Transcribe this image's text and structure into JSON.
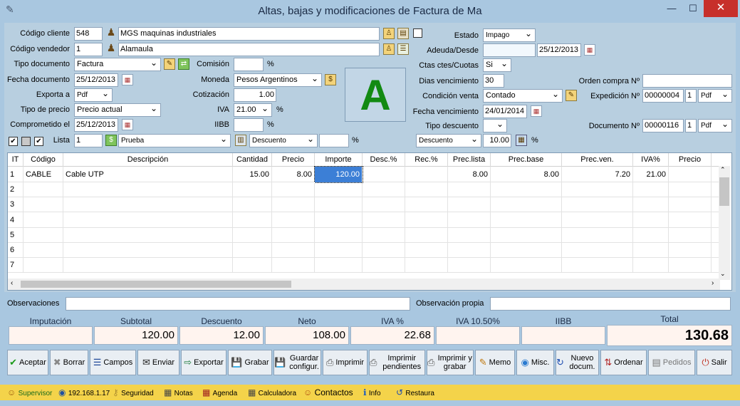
{
  "window": {
    "title": "Altas, bajas y modificaciones de Factura de Ma",
    "min": "—",
    "max": "☐",
    "close": "✕"
  },
  "header": {
    "codigo_cliente_label": "Código cliente",
    "codigo_cliente": "548",
    "cliente_nombre": "MGS maquinas industriales",
    "codigo_vendedor_label": "Código vendedor",
    "codigo_vendedor": "1",
    "vendedor_nombre": "Alamaula",
    "tipo_documento_label": "Tipo documento",
    "tipo_documento": "Factura",
    "comision_label": "Comisión",
    "comision": "",
    "pct": "%",
    "fecha_documento_label": "Fecha documento",
    "fecha_documento": "25/12/2013",
    "moneda_label": "Moneda",
    "moneda": "Pesos Argentinos",
    "exporta_label": "Exporta a",
    "exporta": "Pdf",
    "cotizacion_label": "Cotización",
    "cotizacion": "1.00",
    "tipo_precio_label": "Tipo de precio",
    "tipo_precio": "Precio actual",
    "iva_label": "IVA",
    "iva": "21.00",
    "comprometido_label": "Comprometido el",
    "comprometido": "25/12/2013",
    "iibb_label": "IIBB",
    "iibb": "",
    "lista_label": "Lista",
    "lista": "1",
    "lista_nombre": "Prueba",
    "descuento_tipo": "Descuento",
    "descuento_valor": "",
    "letra": "A",
    "estado_label": "Estado",
    "estado": "Impago",
    "adeuda_label": "Adeuda/Desde",
    "adeuda": "",
    "adeuda_fecha": "25/12/2013",
    "ctas_label": "Ctas ctes/Cuotas",
    "ctas": "Si",
    "dias_label": "Dias vencimiento",
    "dias": "30",
    "orden_label": "Orden compra Nº",
    "orden": "",
    "condicion_label": "Condición venta",
    "condicion": "Contado",
    "expedicion_label": "Expedición Nº",
    "expedicion": "00000004",
    "expedicion_n": "1",
    "expedicion_fmt": "Pdf",
    "fecha_venc_label": "Fecha vencimiento",
    "fecha_venc": "24/01/2014",
    "tipo_desc_label": "Tipo descuento",
    "tipo_desc": "",
    "documento_label": "Documento Nº",
    "documento": "00000116",
    "documento_n": "1",
    "documento_fmt": "Pdf",
    "desc2_tipo": "Descuento",
    "desc2_valor": "10.00"
  },
  "grid": {
    "columns": [
      "IT",
      "Código",
      "Descripción",
      "Cantidad",
      "Precio",
      "Importe",
      "Desc.%",
      "Rec.%",
      "Prec.lista",
      "Prec.base",
      "Prec.ven.",
      "IVA%",
      "Precio"
    ],
    "rows": [
      [
        "1",
        "CABLE",
        "Cable UTP",
        "15.00",
        "8.00",
        "120.00",
        "",
        "",
        "8.00",
        "8.00",
        "7.20",
        "21.00",
        ""
      ],
      [
        "2",
        "",
        "",
        "",
        "",
        "",
        "",
        "",
        "",
        "",
        "",
        "",
        ""
      ],
      [
        "3",
        "",
        "",
        "",
        "",
        "",
        "",
        "",
        "",
        "",
        "",
        "",
        ""
      ],
      [
        "4",
        "",
        "",
        "",
        "",
        "",
        "",
        "",
        "",
        "",
        "",
        "",
        ""
      ],
      [
        "5",
        "",
        "",
        "",
        "",
        "",
        "",
        "",
        "",
        "",
        "",
        "",
        ""
      ],
      [
        "6",
        "",
        "",
        "",
        "",
        "",
        "",
        "",
        "",
        "",
        "",
        "",
        ""
      ],
      [
        "7",
        "",
        "",
        "",
        "",
        "",
        "",
        "",
        "",
        "",
        "",
        "",
        ""
      ]
    ]
  },
  "obs": {
    "observaciones_label": "Observaciones",
    "observaciones": "",
    "propia_label": "Observación propia",
    "propia": ""
  },
  "totals": {
    "labels": [
      "Imputación",
      "Subtotal",
      "Descuento",
      "Neto",
      "IVA %",
      "IVA 10.50%",
      "IIBB",
      "Total"
    ],
    "values": [
      "",
      "120.00",
      "12.00",
      "108.00",
      "22.68",
      "",
      "",
      "130.68"
    ]
  },
  "buttons": [
    {
      "label": "Aceptar",
      "icon": "✔"
    },
    {
      "label": "Borrar",
      "icon": "✖"
    },
    {
      "label": "Campos",
      "icon": "☰"
    },
    {
      "label": "Enviar",
      "icon": "✉"
    },
    {
      "label": "Exportar",
      "icon": "⇨"
    },
    {
      "label": "Grabar",
      "icon": "💾"
    },
    {
      "label": "Guardar configur.",
      "icon": "💾"
    },
    {
      "label": "Imprimir",
      "icon": "⎙"
    },
    {
      "label": "Imprimir pendientes",
      "icon": "⎙"
    },
    {
      "label": "Imprimir y grabar",
      "icon": "⎙"
    },
    {
      "label": "Memo",
      "icon": "✎"
    },
    {
      "label": "Misc.",
      "icon": "◉"
    },
    {
      "label": "Nuevo docum.",
      "icon": "↻"
    },
    {
      "label": "Ordenar",
      "icon": "⇅"
    },
    {
      "label": "Pedidos",
      "icon": "▤"
    },
    {
      "label": "Salir",
      "icon": "⏻"
    }
  ],
  "status": [
    "Supervisor",
    "192.168.1.17",
    "Seguridad",
    "Notas",
    "Agenda",
    "Calculadora",
    "Contactos",
    "Info",
    "Restaura"
  ]
}
